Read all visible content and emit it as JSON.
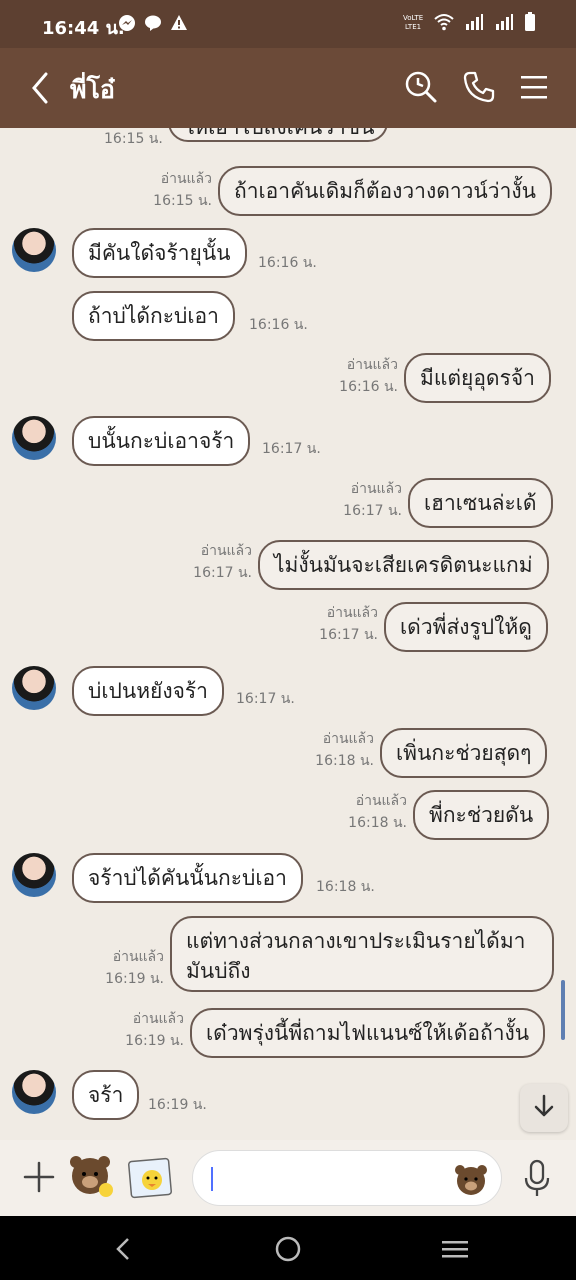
{
  "status": {
    "time": "16:44 น."
  },
  "header": {
    "title": "พี่โอ๋"
  },
  "partial_top": {
    "text": "ให้เอาไปส่งเค้นว่าขัน",
    "time": "16:15 น."
  },
  "messages": [
    {
      "dir": "out",
      "text": "ถ้าเอาคันเดิมก็ต้องวางดาวน์ว่างั้น",
      "read": "อ่านแล้ว",
      "time": "16:15 น."
    },
    {
      "dir": "in",
      "text": "มีคันใด๋จร้ายุนั้น",
      "time": "16:16 น."
    },
    {
      "dir": "in",
      "text": "ถ้าบ่ได้กะบ่เอา",
      "time": "16:16 น."
    },
    {
      "dir": "out",
      "text": "มีแต่ยุอุดรจ้า",
      "read": "อ่านแล้ว",
      "time": "16:16 น."
    },
    {
      "dir": "in",
      "text": "บนั้นกะบ่เอาจร้า",
      "time": "16:17 น."
    },
    {
      "dir": "out",
      "text": "เฮาเซนล่ะเด้",
      "read": "อ่านแล้ว",
      "time": "16:17 น."
    },
    {
      "dir": "out",
      "text": "ไม่งั้นมันจะเสียเครดิตนะแกม่",
      "read": "อ่านแล้ว",
      "time": "16:17 น."
    },
    {
      "dir": "out",
      "text": "เด่วพี่ส่งรูปให้ดู",
      "read": "อ่านแล้ว",
      "time": "16:17 น."
    },
    {
      "dir": "in",
      "text": "บ่เปนหยังจร้า",
      "time": "16:17 น."
    },
    {
      "dir": "out",
      "text": "เพิ่นกะช่วยสุดๆ",
      "read": "อ่านแล้ว",
      "time": "16:18 น."
    },
    {
      "dir": "out",
      "text": "พี่กะช่วยดัน",
      "read": "อ่านแล้ว",
      "time": "16:18 น."
    },
    {
      "dir": "in",
      "text": "จร้าบ่ได้คันนั้นกะบ่เอา",
      "time": "16:18 น."
    },
    {
      "dir": "out",
      "text": "แต่ทางส่วนกลางเขาประเมินรายได้มา มันบ่ถึง",
      "read": "อ่านแล้ว",
      "time": "16:19 น."
    },
    {
      "dir": "out",
      "text": "เด๋วพรุ่งนี้พี่ถามไฟแนนซ์ให้เด้อถ้างั้น",
      "read": "อ่านแล้ว",
      "time": "16:19 น."
    },
    {
      "dir": "in",
      "text": "จร้า",
      "time": "16:19 น."
    }
  ],
  "input": {
    "placeholder": ""
  },
  "colors": {
    "header": "#6b4a38",
    "statusbar": "#5d4031",
    "chat_bg": "#f0ebe4"
  },
  "icons": [
    "back-icon",
    "search-clock-icon",
    "phone-icon",
    "menu-icon",
    "plus-icon",
    "sticker-icon",
    "photo-icon",
    "emoji-icon",
    "mic-icon",
    "scroll-down-icon"
  ]
}
